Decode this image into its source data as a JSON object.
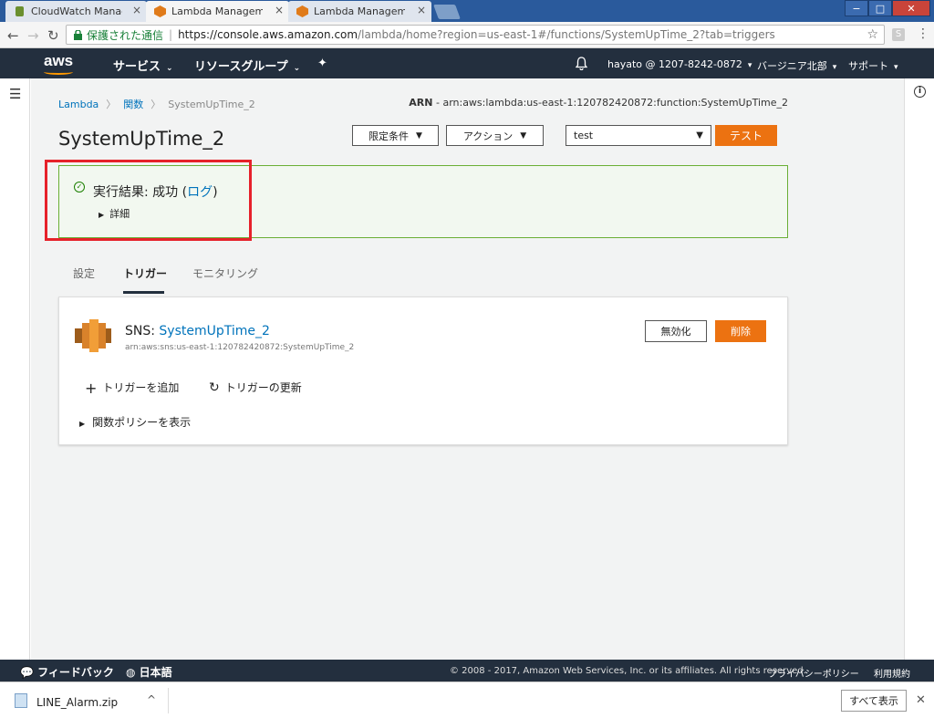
{
  "browser": {
    "tabs": [
      {
        "label": "CloudWatch Managem",
        "close": "×"
      },
      {
        "label": "Lambda Management",
        "close": "×"
      },
      {
        "label": "Lambda Management",
        "close": "×"
      }
    ],
    "window_buttons": {
      "minimize": "−",
      "maximize": "□",
      "close": "✕"
    },
    "secure_label": "保護された通信",
    "url_scheme_host": "https://console.aws.amazon.com",
    "url_path": "/lambda/home?region=us-east-1#/functions/SystemUpTime_2?tab=triggers",
    "ext_label": "S"
  },
  "awsnav": {
    "logo": "aws",
    "services": "サービス",
    "resource_groups": "リソースグループ",
    "account": "hayato @ 1207-8242-0872",
    "region": "バージニア北部",
    "support": "サポート"
  },
  "breadcrumb": {
    "items": [
      "Lambda",
      "関数",
      "SystemUpTime_2"
    ]
  },
  "arn": {
    "label": "ARN",
    "value": " - arn:aws:lambda:us-east-1:120782420872:function:SystemUpTime_2"
  },
  "function": {
    "name": "SystemUpTime_2",
    "qualifiers_label": "限定条件",
    "actions_label": "アクション",
    "test_event": "test",
    "test_label": "テスト"
  },
  "result": {
    "text_prefix": "実行結果: 成功 (",
    "log_link": "ログ",
    "text_suffix": ")",
    "details": "詳細"
  },
  "tabs": [
    "設定",
    "トリガー",
    "モニタリング"
  ],
  "trigger": {
    "type_label": "SNS: ",
    "name": "SystemUpTime_2",
    "arn": "arn:aws:sns:us-east-1:120782420872:SystemUpTime_2",
    "disable_label": "無効化",
    "delete_label": "削除",
    "add_label": "トリガーを追加",
    "refresh_label": "トリガーの更新",
    "policy_label": "関数ポリシーを表示"
  },
  "footer": {
    "feedback": "フィードバック",
    "language": "日本語",
    "copyright": "© 2008 - 2017, Amazon Web Services, Inc. or its affiliates. All rights reserved.",
    "privacy": "プライバシーポリシー",
    "terms": "利用規約"
  },
  "downloads": {
    "file": "LINE_Alarm.zip",
    "show_all": "すべて表示"
  },
  "colors": {
    "aws_nav": "#232f3e",
    "accent_orange": "#ec7211",
    "link_blue": "#0073bb",
    "success_green": "#1d8102",
    "highlight_red": "#e6212a"
  },
  "icons": [
    "cloudwatch-favicon",
    "lambda-favicon",
    "back-icon",
    "forward-icon",
    "reload-icon",
    "lock-icon",
    "star-icon",
    "bell-icon",
    "pin-icon",
    "menu-icon",
    "info-icon",
    "check-circle-icon",
    "sns-icon",
    "plus-icon",
    "refresh-icon",
    "feedback-icon",
    "globe-icon",
    "zip-file-icon"
  ]
}
